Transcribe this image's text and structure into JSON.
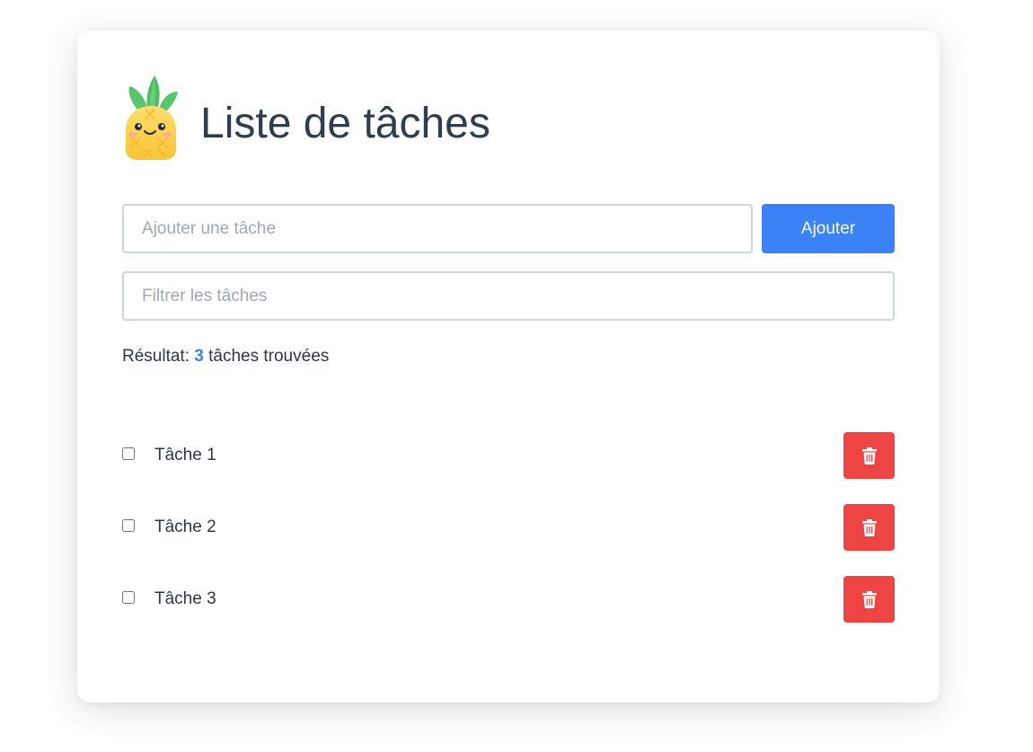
{
  "header": {
    "title": "Liste de tâches",
    "logo_icon": "pineapple-mascot-icon"
  },
  "add_task": {
    "placeholder": "Ajouter une tâche",
    "value": "",
    "button_label": "Ajouter"
  },
  "filter": {
    "placeholder": "Filtrer les tâches",
    "value": ""
  },
  "result": {
    "prefix": "Résultat:",
    "count": "3",
    "suffix": "tâches trouvées"
  },
  "tasks": [
    {
      "label": "Tâche 1",
      "checked": false
    },
    {
      "label": "Tâche 2",
      "checked": false
    },
    {
      "label": "Tâche 3",
      "checked": false
    }
  ],
  "icons": {
    "delete": "trash-icon"
  },
  "colors": {
    "primary": "#3b82f6",
    "danger": "#ef4444",
    "title_text": "#2c3e50",
    "body_text": "#2d3748",
    "input_border": "#cbd5e0"
  }
}
